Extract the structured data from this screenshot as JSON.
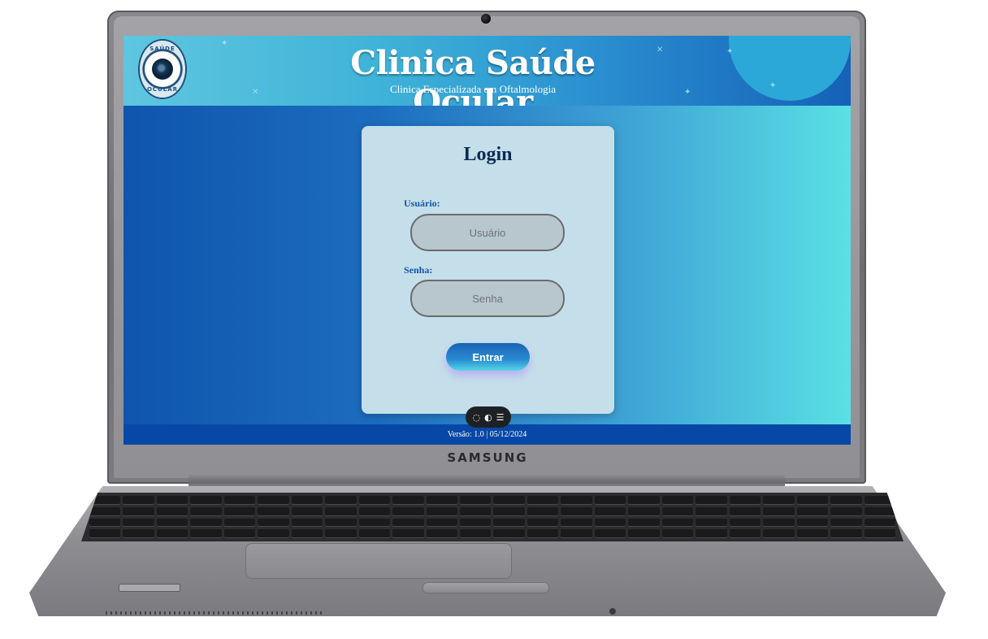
{
  "device": {
    "brand": "SAMSUNG"
  },
  "header": {
    "title": "Clinica Saúde Ocular",
    "subtitle": "Clinica Especializada em Oftalmologia",
    "logo_text_top": "SAÚDE",
    "logo_text_bottom": "OCULAR"
  },
  "login": {
    "title": "Login",
    "username_label": "Usuário:",
    "username_placeholder": "Usuário",
    "password_label": "Senha:",
    "password_placeholder": "Senha",
    "submit_label": "Entrar"
  },
  "footer": {
    "version_text": "Versão: 1.0 | 05/12/2024"
  },
  "toolbar": {
    "icons": [
      "chat-icon",
      "contrast-icon",
      "menu-icon"
    ]
  }
}
